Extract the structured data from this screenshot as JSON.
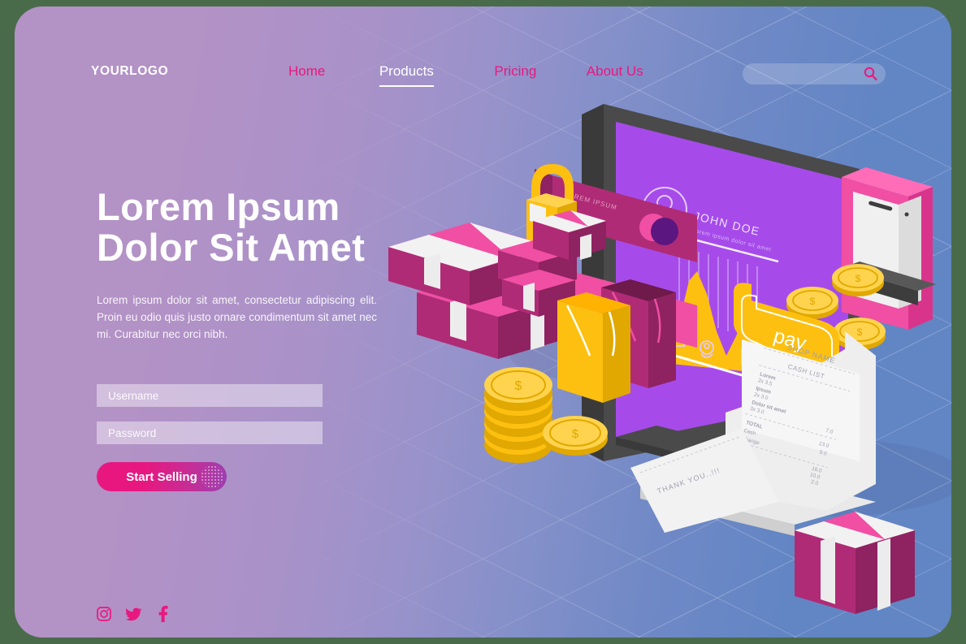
{
  "brand": {
    "logo": "YOURLOGO"
  },
  "nav": {
    "items": [
      {
        "label": "Home",
        "active": false
      },
      {
        "label": "Products",
        "active": true
      },
      {
        "label": "Pricing",
        "active": false
      },
      {
        "label": "About Us",
        "active": false
      }
    ],
    "search": {
      "value": "",
      "placeholder": "",
      "icon": "search-icon"
    }
  },
  "hero": {
    "title_line1": "Lorem Ipsum",
    "title_line2": "Dolor Sit Amet",
    "paragraph": "Lorem ipsum dolor sit amet, consectetur adipiscing elit. Proin eu odio quis justo ornare condimentum sit amet nec mi. Curabitur nec orci nibh."
  },
  "form": {
    "username": {
      "value": "",
      "placeholder": "Username"
    },
    "password": {
      "value": "",
      "placeholder": "Password"
    },
    "cta_label": "Start Selling"
  },
  "social": [
    {
      "name": "instagram-icon",
      "label": "Instagram"
    },
    {
      "name": "twitter-icon",
      "label": "Twitter"
    },
    {
      "name": "facebook-icon",
      "label": "Facebook"
    }
  ],
  "illustration": {
    "monitor_screen": {
      "user_name": "JOHN DOE",
      "user_subtitle": "lorem ipsum dolor sit amet",
      "pay_button": "pay"
    },
    "credit_card": {
      "label": "LOREM IPSUM"
    },
    "receipt": {
      "shop_name": "SHOP NAME",
      "section": "CASH LIST",
      "items": [
        {
          "name": "Lorem",
          "qty": "2x 3.5"
        },
        {
          "name": "Ipsum",
          "qty": "2x 3.0"
        },
        {
          "name": "Dolor sit amet",
          "qty": "3x 3.0",
          "price": "7.0"
        }
      ],
      "total_label": "TOTAL",
      "total_value": "13.0",
      "cash_label": "Cash",
      "cash_value": "9.0",
      "change_label": "Change",
      "change_values": [
        "16.0",
        "10.0",
        "2.0"
      ]
    },
    "thank_you": "THANK YOU..!!!",
    "coin_symbol": "$"
  },
  "colors": {
    "page_outer": "#4a6b4a",
    "bg_left": "#b392c6",
    "bg_right": "#6285c4",
    "accent_pink": "#e8187f",
    "accent_magenta": "#f04fa3",
    "accent_purple": "#a64bea",
    "accent_yellow": "#fdc010",
    "white": "#ffffff",
    "dark_grey": "#4a4a4a"
  }
}
